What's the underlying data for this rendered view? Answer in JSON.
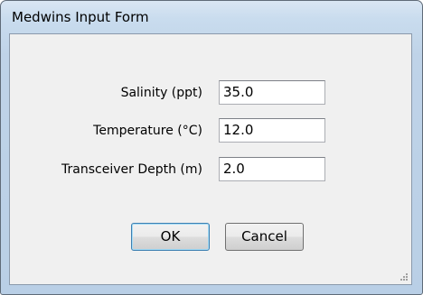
{
  "window": {
    "title": "Medwins Input Form"
  },
  "form": {
    "fields": [
      {
        "label": "Salinity (ppt)",
        "value": "35.0"
      },
      {
        "label": "Temperature (°C)",
        "value": "12.0"
      },
      {
        "label": "Transceiver Depth (m)",
        "value": "2.0"
      }
    ]
  },
  "buttons": {
    "ok_label": "OK",
    "cancel_label": "Cancel"
  }
}
